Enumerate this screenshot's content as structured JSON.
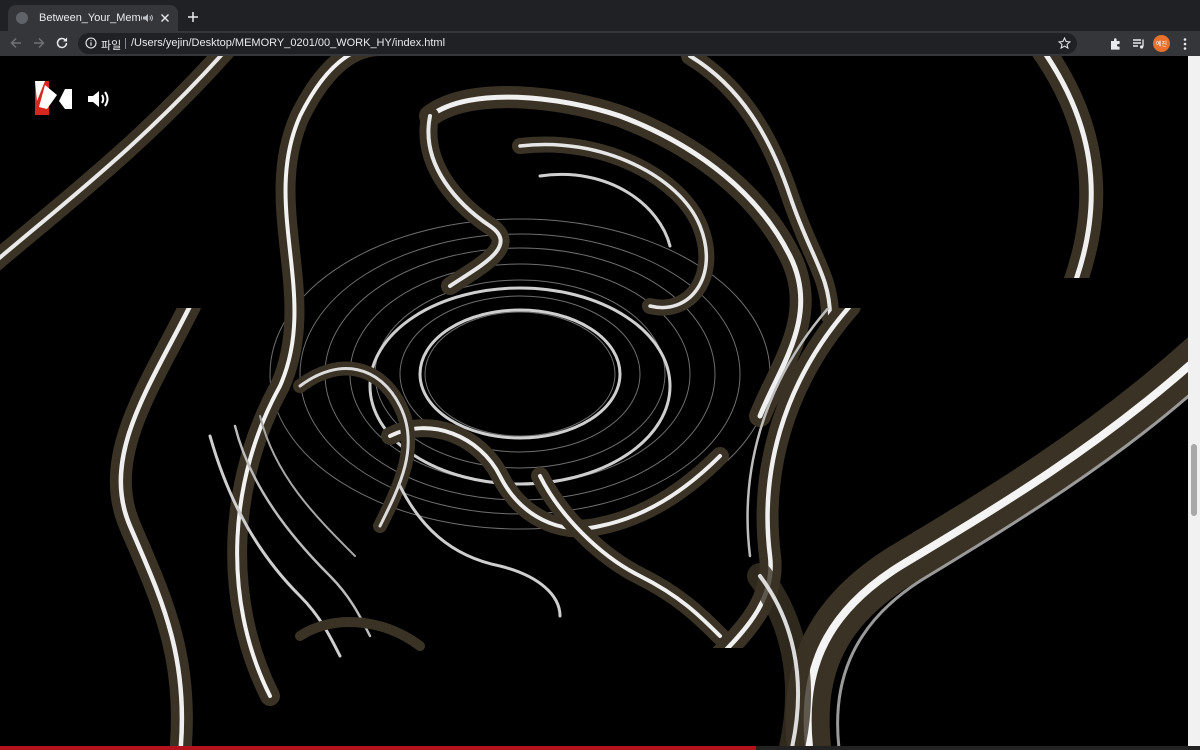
{
  "tab": {
    "title": "Between_Your_Memories",
    "favicon_icon": "globe-icon",
    "audio_icon": "tab-audio-icon",
    "close_icon": "close-icon"
  },
  "toolbar": {
    "scheme_label": "파일",
    "url": "/Users/yejin/Desktop/MEMORY_0201/00_WORK_HY/index.html",
    "profile_label": "예진"
  },
  "page": {
    "logo_icon": "brand-logo-icon",
    "speaker_icon": "speaker-volume-icon"
  },
  "progress": {
    "fraction": 0.63,
    "color": "#b3121c"
  },
  "colors": {
    "tabstrip": "#202124",
    "toolbar": "#35363a",
    "profile": "#e8712d"
  }
}
